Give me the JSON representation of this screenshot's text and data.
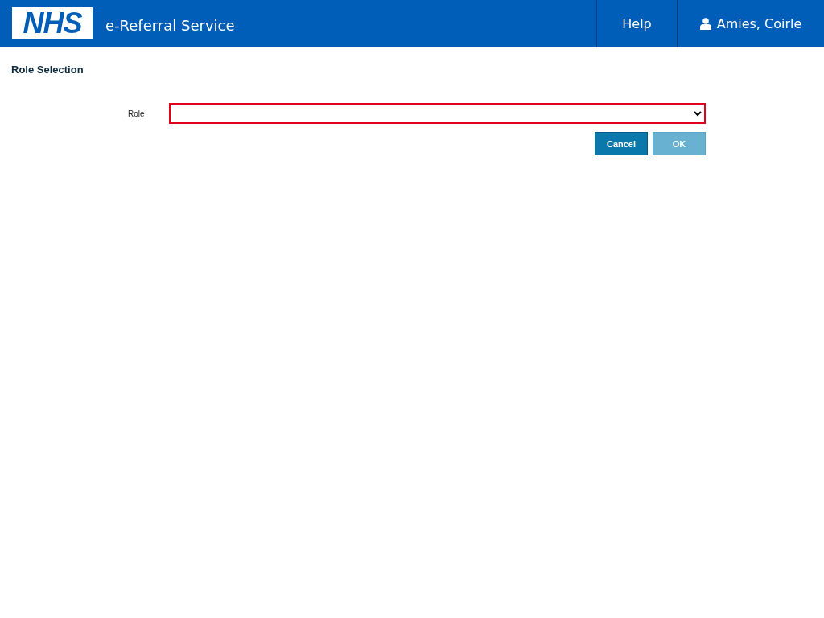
{
  "header": {
    "logo": "NHS",
    "title": "e-Referral Service",
    "help": "Help",
    "user": "Amies, Coirle"
  },
  "page_title": "Role Selection",
  "role_field": {
    "label": "Role",
    "invalid": true
  },
  "buttons": [
    {
      "label": "Cancel",
      "disabled": false
    },
    {
      "label": "OK",
      "disabled": true
    }
  ]
}
